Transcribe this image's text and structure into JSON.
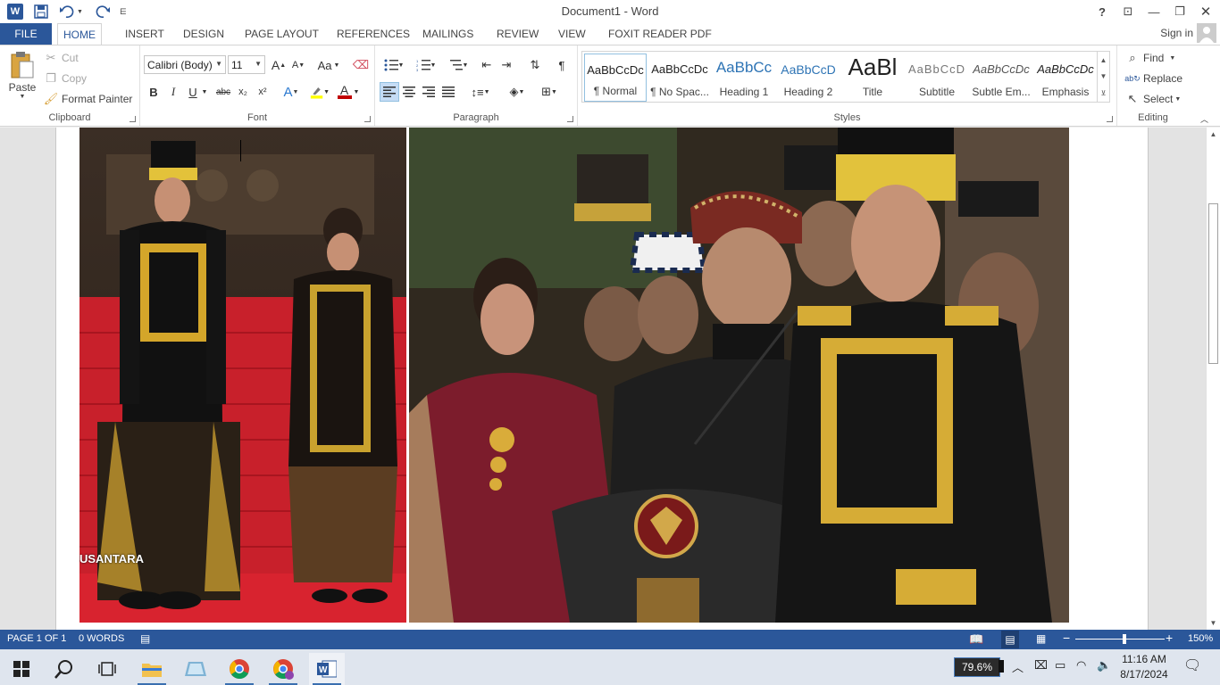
{
  "window": {
    "title": "Document1 - Word",
    "help": "?",
    "restore_ribbon": "⊡",
    "minimize": "—",
    "maximize": "❐",
    "close": "✕"
  },
  "quick_access": {
    "app_icon": "W",
    "save_icon": "save-icon",
    "undo_icon": "undo-icon",
    "redo_icon": "redo-icon"
  },
  "tabs": {
    "file": "FILE",
    "items": [
      "HOME",
      "INSERT",
      "DESIGN",
      "PAGE LAYOUT",
      "REFERENCES",
      "MAILINGS",
      "REVIEW",
      "VIEW",
      "FOXIT READER PDF"
    ],
    "active": "HOME",
    "sign_in": "Sign in"
  },
  "clipboard": {
    "label": "Clipboard",
    "paste": "Paste",
    "cut": "Cut",
    "copy": "Copy",
    "format_painter": "Format Painter"
  },
  "font": {
    "label": "Font",
    "font_name": "Calibri (Body)",
    "font_size": "11",
    "grow": "A",
    "shrink": "A",
    "change_case": "Aa",
    "bold": "B",
    "italic": "I",
    "underline": "U",
    "strikethrough": "abc",
    "subscript": "x₂",
    "superscript": "x²",
    "text_effects": "A",
    "font_color": "A"
  },
  "paragraph": {
    "label": "Paragraph",
    "show_marks": "¶"
  },
  "styles": {
    "label": "Styles",
    "items": [
      {
        "preview": "AaBbCcDc",
        "name": "¶ Normal"
      },
      {
        "preview": "AaBbCcDc",
        "name": "¶ No Spac..."
      },
      {
        "preview": "AaBbCc",
        "name": "Heading 1"
      },
      {
        "preview": "AaBbCcD",
        "name": "Heading 2"
      },
      {
        "preview": "AaBl",
        "name": "Title"
      },
      {
        "preview": "AaBbCcD",
        "name": "Subtitle"
      },
      {
        "preview": "AaBbCcDc",
        "name": "Subtle Em..."
      },
      {
        "preview": "AaBbCcDc",
        "name": "Emphasis"
      }
    ],
    "selected": "¶ Normal"
  },
  "editing": {
    "label": "Editing",
    "find": "Find",
    "replace": "Replace",
    "select": "Select"
  },
  "document": {
    "photo_caption": "USANTARA"
  },
  "statusbar": {
    "page": "PAGE 1 OF 1",
    "words": "0 WORDS",
    "zoom": "150%",
    "zoom_level": 0.55
  },
  "taskbar": {
    "battery": "79.6%",
    "time": "11:16 AM",
    "date": "8/17/2024"
  },
  "colors": {
    "accent": "#2b579a",
    "highlight": "#ffff00",
    "font_color": "#c00000"
  }
}
